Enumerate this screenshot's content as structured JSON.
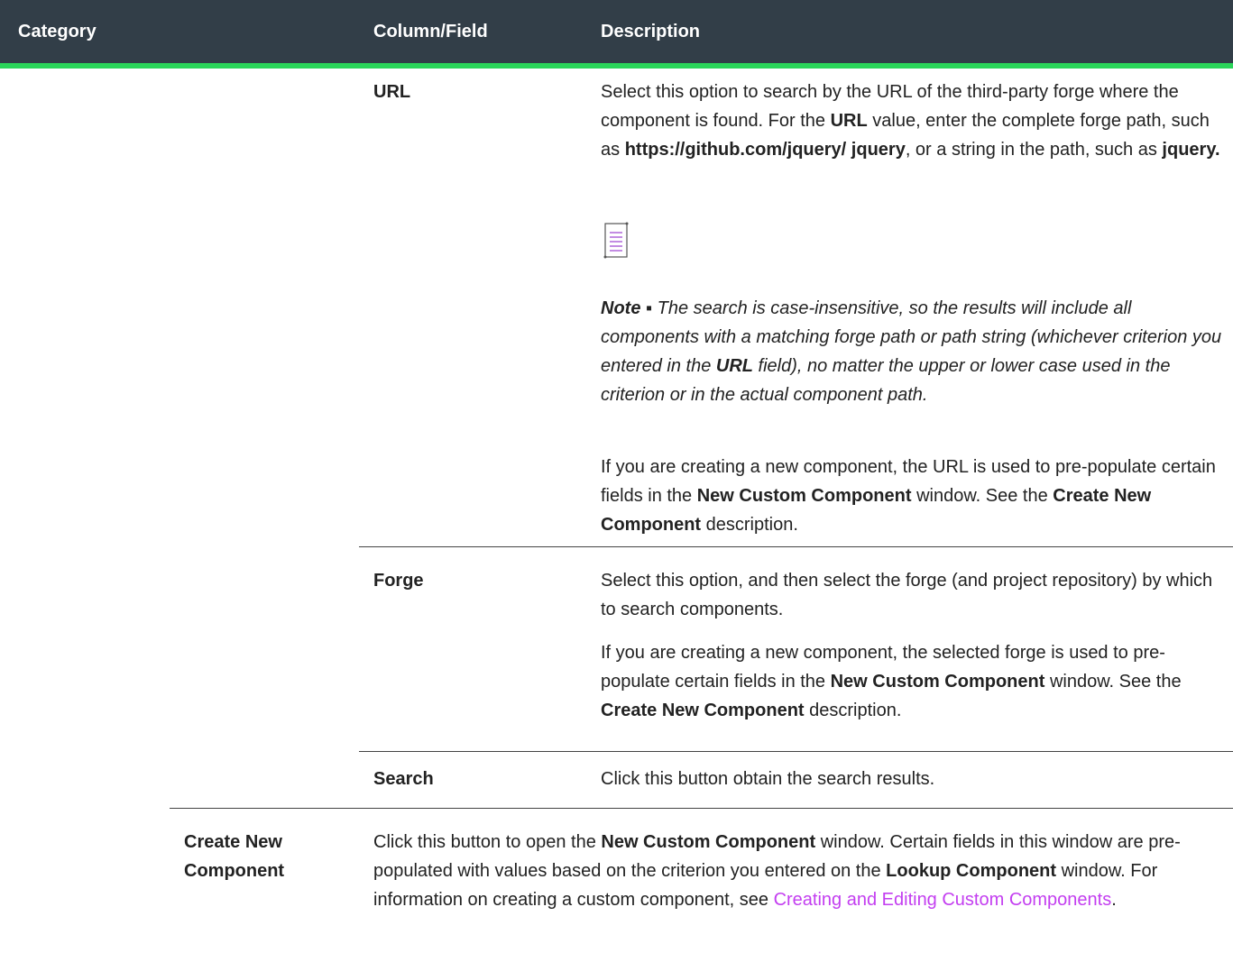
{
  "header": {
    "category": "Category",
    "column_field": "Column/Field",
    "description": "Description"
  },
  "rows": {
    "url": {
      "field": "URL",
      "d1": "Select this option to search by the URL of the third-party forge where the component is found. For the ",
      "d1_b1": "URL",
      "d1_2": " value, enter the complete forge path, such as ",
      "d1_b2": "https://github.com/jquery/ jquery",
      "d1_3": ", or a string in the path, such as ",
      "d1_b3": "jquery.",
      "note_label": "Note",
      "note_sep": " ▪ ",
      "note_1": "The search is case-insensitive, so the results will include all components with a matching forge path or path string (whichever criterion you entered in the ",
      "note_b": "URL",
      "note_2": " field), no matter the upper or lower case used in the criterion or in the actual component path.",
      "d2_1": "If you are creating a new component, the URL is used to pre-populate certain fields in the ",
      "d2_b1": "New Custom Component",
      "d2_2": " window. See the ",
      "d2_b2": "Create New Component",
      "d2_3": " description."
    },
    "forge": {
      "field": "Forge",
      "d1": "Select this option, and then select the forge (and project repository) by which to search components.",
      "d2_1": "If you are creating a new component, the selected forge is used to pre-populate certain fields in the ",
      "d2_b1": "New Custom Component",
      "d2_2": " window. See the ",
      "d2_b2": "Create New Component",
      "d2_3": " description."
    },
    "search": {
      "field": "Search",
      "d1": "Click this button obtain the search results."
    },
    "create": {
      "field": "Create New Component",
      "d1": "Click this button to open the ",
      "d1_b1": "New Custom Component",
      "d1_2": " window. Certain fields in this window are pre-populated with values based on the criterion you entered on the ",
      "d1_b2": "Lookup Component",
      "d1_3": " window. For information on creating a custom component, see ",
      "link": "Creating and Editing Custom Components",
      "d1_4": "."
    }
  },
  "icons": {
    "note": "note-document-icon"
  },
  "colors": {
    "header_bg": "#323e48",
    "header_accent": "#2bd55a",
    "link": "#c33ef0"
  }
}
